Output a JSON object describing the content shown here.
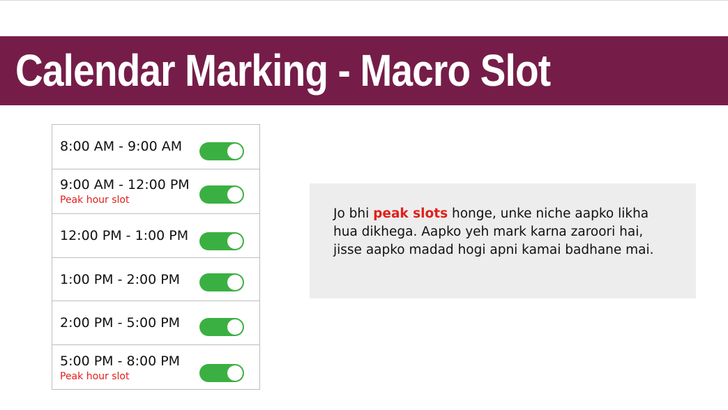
{
  "header": {
    "title": "Calendar Marking - Macro Slot",
    "band_color": "#751d48"
  },
  "slots": [
    {
      "time": "8:00 AM - 9:00 AM",
      "note": "",
      "enabled": true
    },
    {
      "time": "9:00 AM - 12:00 PM",
      "note": "Peak hour slot",
      "enabled": true
    },
    {
      "time": "12:00 PM - 1:00 PM",
      "note": "",
      "enabled": true
    },
    {
      "time": "1:00 PM - 2:00 PM",
      "note": "",
      "enabled": true
    },
    {
      "time": "2:00 PM - 5:00 PM",
      "note": "",
      "enabled": true
    },
    {
      "time": "5:00 PM - 8:00 PM",
      "note": "Peak hour slot",
      "enabled": true
    }
  ],
  "info": {
    "prefix": "Jo bhi ",
    "highlight": "peak slots",
    "suffix": " honge, unke niche aapko likha hua dikhega. Aapko yeh mark karna zaroori hai, jisse aapko madad hogi apni kamai badhane mai."
  },
  "colors": {
    "toggle_on": "#3bb042",
    "peak_note": "#e0201a"
  }
}
